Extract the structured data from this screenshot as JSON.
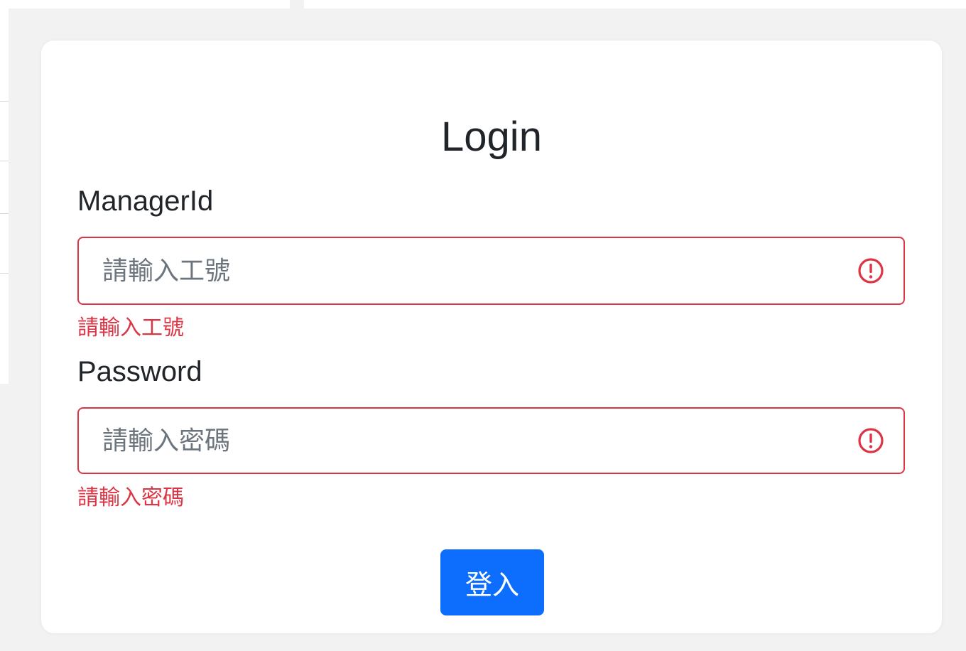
{
  "login_form": {
    "title": "Login",
    "manager_id": {
      "label": "ManagerId",
      "placeholder": "請輸入工號",
      "value": "",
      "error": "請輸入工號",
      "status_icon": "exclamation-circle-icon"
    },
    "password": {
      "label": "Password",
      "placeholder": "請輸入密碼",
      "value": "",
      "error": "請輸入密碼",
      "status_icon": "exclamation-circle-icon"
    },
    "submit_label": "登入"
  },
  "colors": {
    "error": "#dc3545",
    "primary": "#0d6efd",
    "text": "#212529",
    "placeholder": "#6c757d",
    "background": "#f2f2f2"
  }
}
